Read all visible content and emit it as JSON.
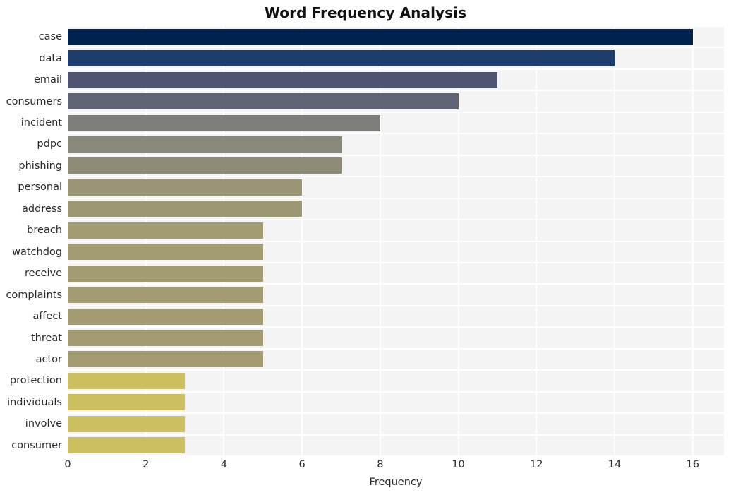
{
  "chart_data": {
    "type": "bar",
    "orientation": "horizontal",
    "title": "Word Frequency Analysis",
    "xlabel": "Frequency",
    "ylabel": "",
    "xlim": [
      0,
      16.8
    ],
    "xticks": [
      0,
      2,
      4,
      6,
      8,
      10,
      12,
      14,
      16
    ],
    "xtick_labels": [
      "0",
      "2",
      "4",
      "6",
      "8",
      "10",
      "12",
      "14",
      "16"
    ],
    "grid": true,
    "legend": "none",
    "categories": [
      "case",
      "data",
      "email",
      "consumers",
      "incident",
      "pdpc",
      "phishing",
      "personal",
      "address",
      "breach",
      "watchdog",
      "receive",
      "complaints",
      "affect",
      "threat",
      "actor",
      "protection",
      "individuals",
      "involve",
      "consumer"
    ],
    "values": [
      16,
      14,
      11,
      10,
      8,
      7,
      7,
      6,
      6,
      5,
      5,
      5,
      5,
      5,
      5,
      5,
      3,
      3,
      3,
      3
    ],
    "bar_colors": [
      "#00224e",
      "#1c3d6e",
      "#515470",
      "#5f6373",
      "#7d7d79",
      "#8a8878",
      "#8e8b77",
      "#9a9675",
      "#9c9874",
      "#a39b72",
      "#a39b72",
      "#a39b72",
      "#a39b72",
      "#a39b72",
      "#a39b72",
      "#a39b72",
      "#ccbf5f",
      "#ccbf5f",
      "#ccbf5f",
      "#ccbf5f"
    ],
    "style": {
      "plot_background": "#f4f4f4",
      "grid_color": "#ffffff",
      "figure_background": "#ffffff",
      "text_color": "#2b2b2b",
      "colormap": "cividis"
    }
  }
}
